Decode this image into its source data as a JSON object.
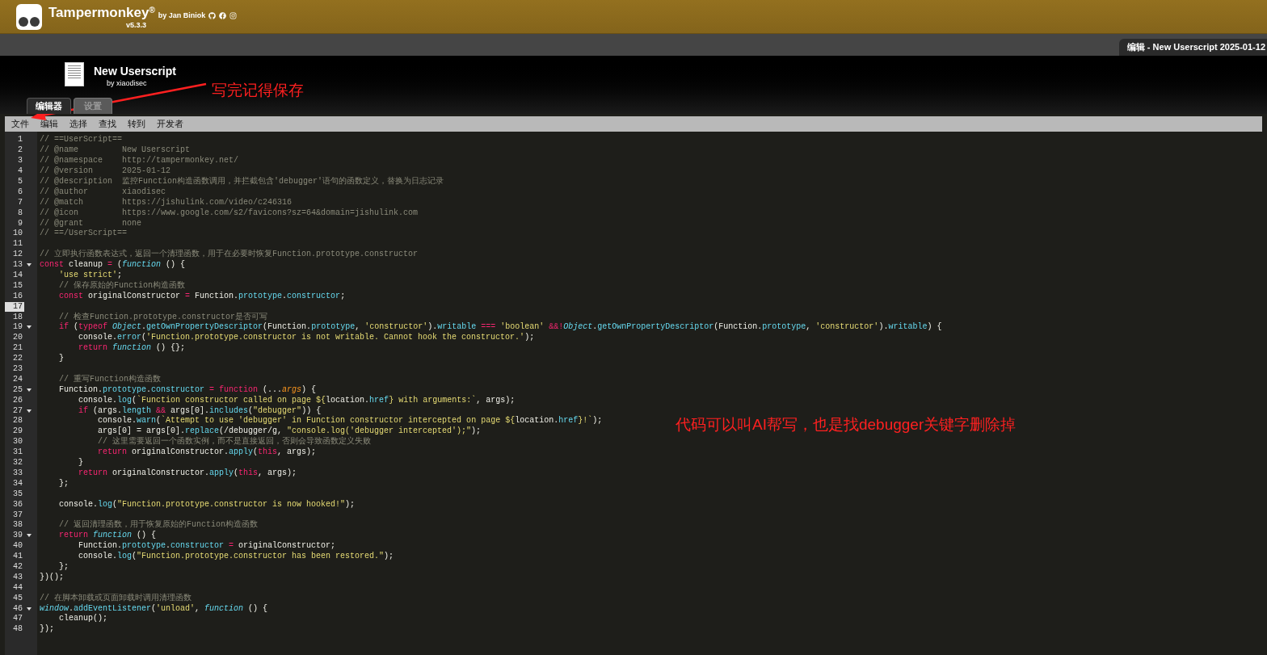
{
  "app": {
    "name": "Tampermonkey",
    "mark": "®",
    "byline": "by Jan Biniok",
    "version": "v5.3.3"
  },
  "open_tab": {
    "label": "编辑 - New Userscript 2025-01-12"
  },
  "script": {
    "title": "New Userscript",
    "author": "by xiaodisec"
  },
  "tabs": [
    {
      "label": "编辑器",
      "selected": true
    },
    {
      "label": "设置",
      "selected": false
    }
  ],
  "menu": [
    "文件",
    "编辑",
    "选择",
    "查找",
    "转到",
    "开发者"
  ],
  "editor": {
    "lines": [
      {
        "number": "1",
        "fold": false,
        "active": false,
        "tokens": [
          {
            "kind": "comment",
            "text": "// ==UserScript=="
          }
        ]
      },
      {
        "number": "2",
        "fold": false,
        "active": false,
        "tokens": [
          {
            "kind": "comment",
            "text": "// @name         New Userscript"
          }
        ]
      },
      {
        "number": "3",
        "fold": false,
        "active": false,
        "tokens": [
          {
            "kind": "comment",
            "text": "// @namespace    http://tampermonkey.net/"
          }
        ]
      },
      {
        "number": "4",
        "fold": false,
        "active": false,
        "tokens": [
          {
            "kind": "comment",
            "text": "// @version      2025-01-12"
          }
        ]
      },
      {
        "number": "5",
        "fold": false,
        "active": false,
        "tokens": [
          {
            "kind": "comment",
            "text": "// @description  监控Function构造函数调用，并拦截包含'debugger'语句的函数定义，替换为日志记录"
          }
        ]
      },
      {
        "number": "6",
        "fold": false,
        "active": false,
        "tokens": [
          {
            "kind": "comment",
            "text": "// @author       xiaodisec"
          }
        ]
      },
      {
        "number": "7",
        "fold": false,
        "active": false,
        "tokens": [
          {
            "kind": "comment",
            "text": "// @match        https://jishulink.com/video/c246316"
          }
        ]
      },
      {
        "number": "8",
        "fold": false,
        "active": false,
        "tokens": [
          {
            "kind": "comment",
            "text": "// @icon         https://www.google.com/s2/favicons?sz=64&domain=jishulink.com"
          }
        ]
      },
      {
        "number": "9",
        "fold": false,
        "active": false,
        "tokens": [
          {
            "kind": "comment",
            "text": "// @grant        none"
          }
        ]
      },
      {
        "number": "10",
        "fold": false,
        "active": false,
        "tokens": [
          {
            "kind": "comment",
            "text": "// ==/UserScript=="
          }
        ]
      },
      {
        "number": "11",
        "fold": false,
        "active": false
      },
      {
        "number": "12",
        "fold": false,
        "active": false,
        "tokens": [
          {
            "kind": "comment",
            "text": "// 立即执行函数表达式，返回一个清理函数，用于在必要时恢复Function.prototype.constructor"
          }
        ]
      },
      {
        "number": "13",
        "fold": true,
        "active": false,
        "tokens": [
          {
            "kind": "keyword",
            "text": "const"
          },
          {
            "kind": "plain",
            "text": " cleanup "
          },
          {
            "kind": "keyword",
            "text": "="
          },
          {
            "kind": "plain",
            "text": " ("
          },
          {
            "kind": "italic",
            "text": "function"
          },
          {
            "kind": "plain",
            "text": " () {"
          }
        ]
      },
      {
        "number": "14",
        "fold": false,
        "active": false,
        "tokens": [
          {
            "kind": "string",
            "text": "    'use strict'"
          },
          {
            "kind": "plain",
            "text": ";"
          }
        ]
      },
      {
        "number": "15",
        "fold": false,
        "active": false,
        "tokens": [
          {
            "kind": "comment",
            "text": "    // 保存原始的Function构造函数"
          }
        ]
      },
      {
        "number": "16",
        "fold": false,
        "active": false,
        "tokens": [
          {
            "kind": "keyword",
            "text": "    const"
          },
          {
            "kind": "plain",
            "text": " originalConstructor "
          },
          {
            "kind": "keyword",
            "text": "="
          },
          {
            "kind": "plain",
            "text": " Function."
          },
          {
            "kind": "member",
            "text": "prototype"
          },
          {
            "kind": "plain",
            "text": "."
          },
          {
            "kind": "member",
            "text": "constructor"
          },
          {
            "kind": "plain",
            "text": ";"
          }
        ]
      },
      {
        "number": "17",
        "fold": false,
        "active": true
      },
      {
        "number": "18",
        "fold": false,
        "active": false,
        "tokens": [
          {
            "kind": "comment",
            "text": "    // 检查Function.prototype.constructor是否可写"
          }
        ]
      },
      {
        "number": "19",
        "fold": true,
        "active": false,
        "tokens": [
          {
            "kind": "keyword",
            "text": "    if"
          },
          {
            "kind": "plain",
            "text": " ("
          },
          {
            "kind": "keyword",
            "text": "typeof "
          },
          {
            "kind": "italic",
            "text": "Object"
          },
          {
            "kind": "plain",
            "text": "."
          },
          {
            "kind": "member",
            "text": "getOwnPropertyDescriptor"
          },
          {
            "kind": "plain",
            "text": "(Function."
          },
          {
            "kind": "member",
            "text": "prototype"
          },
          {
            "kind": "plain",
            "text": ", "
          },
          {
            "kind": "string",
            "text": "'constructor'"
          },
          {
            "kind": "plain",
            "text": ")."
          },
          {
            "kind": "member",
            "text": "writable "
          },
          {
            "kind": "keyword",
            "text": "=== "
          },
          {
            "kind": "string",
            "text": "'boolean' "
          },
          {
            "kind": "keyword",
            "text": "&&!"
          },
          {
            "kind": "italic",
            "text": "Object"
          },
          {
            "kind": "plain",
            "text": "."
          },
          {
            "kind": "member",
            "text": "getOwnPropertyDescriptor"
          },
          {
            "kind": "plain",
            "text": "(Function."
          },
          {
            "kind": "member",
            "text": "prototype"
          },
          {
            "kind": "plain",
            "text": ", "
          },
          {
            "kind": "string",
            "text": "'constructor'"
          },
          {
            "kind": "plain",
            "text": ")."
          },
          {
            "kind": "member",
            "text": "writable"
          },
          {
            "kind": "plain",
            "text": ") {"
          }
        ]
      },
      {
        "number": "20",
        "fold": false,
        "active": false,
        "tokens": [
          {
            "kind": "plain",
            "text": "        console."
          },
          {
            "kind": "member",
            "text": "error"
          },
          {
            "kind": "plain",
            "text": "("
          },
          {
            "kind": "string",
            "text": "'Function.prototype.constructor is not writable. Cannot hook the constructor.'"
          },
          {
            "kind": "plain",
            "text": ");"
          }
        ]
      },
      {
        "number": "21",
        "fold": false,
        "active": false,
        "tokens": [
          {
            "kind": "keyword",
            "text": "        return "
          },
          {
            "kind": "italic",
            "text": "function"
          },
          {
            "kind": "plain",
            "text": " () {};"
          }
        ]
      },
      {
        "number": "22",
        "fold": false,
        "active": false,
        "tokens": [
          {
            "kind": "plain",
            "text": "    }"
          }
        ]
      },
      {
        "number": "23",
        "fold": false,
        "active": false
      },
      {
        "number": "24",
        "fold": false,
        "active": false,
        "tokens": [
          {
            "kind": "comment",
            "text": "    // 重写Function构造函数"
          }
        ]
      },
      {
        "number": "25",
        "fold": true,
        "active": false,
        "tokens": [
          {
            "kind": "plain",
            "text": "    Function."
          },
          {
            "kind": "member",
            "text": "prototype"
          },
          {
            "kind": "plain",
            "text": "."
          },
          {
            "kind": "member",
            "text": "constructor "
          },
          {
            "kind": "keyword",
            "text": "= function"
          },
          {
            "kind": "plain",
            "text": " (..."
          },
          {
            "kind": "param",
            "text": "args"
          },
          {
            "kind": "plain",
            "text": ") {"
          }
        ]
      },
      {
        "number": "26",
        "fold": false,
        "active": false,
        "tokens": [
          {
            "kind": "plain",
            "text": "        console."
          },
          {
            "kind": "member",
            "text": "log"
          },
          {
            "kind": "plain",
            "text": "("
          },
          {
            "kind": "string",
            "text": "`Function constructor called on page ${"
          },
          {
            "kind": "plain",
            "text": "location."
          },
          {
            "kind": "member",
            "text": "href"
          },
          {
            "kind": "string",
            "text": "} with arguments:`"
          },
          {
            "kind": "plain",
            "text": ", args);"
          }
        ]
      },
      {
        "number": "27",
        "fold": true,
        "active": false,
        "tokens": [
          {
            "kind": "keyword",
            "text": "        if"
          },
          {
            "kind": "plain",
            "text": " (args."
          },
          {
            "kind": "member",
            "text": "length "
          },
          {
            "kind": "keyword",
            "text": "&&"
          },
          {
            "kind": "plain",
            "text": " args[0]."
          },
          {
            "kind": "member",
            "text": "includes"
          },
          {
            "kind": "plain",
            "text": "("
          },
          {
            "kind": "string",
            "text": "\"debugger\""
          },
          {
            "kind": "plain",
            "text": ")) {"
          }
        ]
      },
      {
        "number": "28",
        "fold": false,
        "active": false,
        "tokens": [
          {
            "kind": "plain",
            "text": "            console."
          },
          {
            "kind": "member",
            "text": "warn"
          },
          {
            "kind": "plain",
            "text": "("
          },
          {
            "kind": "string",
            "text": "`Attempt to use 'debugger' in Function constructor intercepted on page ${"
          },
          {
            "kind": "plain",
            "text": "location."
          },
          {
            "kind": "member",
            "text": "href"
          },
          {
            "kind": "string",
            "text": "}!`"
          },
          {
            "kind": "plain",
            "text": ");"
          }
        ]
      },
      {
        "number": "29",
        "fold": false,
        "active": false,
        "tokens": [
          {
            "kind": "plain",
            "text": "            args[0] = args[0]."
          },
          {
            "kind": "member",
            "text": "replace"
          },
          {
            "kind": "plain",
            "text": "(/debugger/g, "
          },
          {
            "kind": "string",
            "text": "\"console.log('debugger intercepted');\""
          },
          {
            "kind": "plain",
            "text": ");"
          }
        ]
      },
      {
        "number": "30",
        "fold": false,
        "active": false,
        "tokens": [
          {
            "kind": "comment",
            "text": "            // 这里需要返回一个函数实例，而不是直接返回，否则会导致函数定义失败"
          }
        ]
      },
      {
        "number": "31",
        "fold": false,
        "active": false,
        "tokens": [
          {
            "kind": "keyword",
            "text": "            return"
          },
          {
            "kind": "plain",
            "text": " originalConstructor."
          },
          {
            "kind": "member",
            "text": "apply"
          },
          {
            "kind": "plain",
            "text": "("
          },
          {
            "kind": "keyword",
            "text": "this"
          },
          {
            "kind": "plain",
            "text": ", args);"
          }
        ]
      },
      {
        "number": "32",
        "fold": false,
        "active": false,
        "tokens": [
          {
            "kind": "plain",
            "text": "        }"
          }
        ]
      },
      {
        "number": "33",
        "fold": false,
        "active": false,
        "tokens": [
          {
            "kind": "keyword",
            "text": "        return"
          },
          {
            "kind": "plain",
            "text": " originalConstructor."
          },
          {
            "kind": "member",
            "text": "apply"
          },
          {
            "kind": "plain",
            "text": "("
          },
          {
            "kind": "keyword",
            "text": "this"
          },
          {
            "kind": "plain",
            "text": ", args);"
          }
        ]
      },
      {
        "number": "34",
        "fold": false,
        "active": false,
        "tokens": [
          {
            "kind": "plain",
            "text": "    };"
          }
        ]
      },
      {
        "number": "35",
        "fold": false,
        "active": false
      },
      {
        "number": "36",
        "fold": false,
        "active": false,
        "tokens": [
          {
            "kind": "plain",
            "text": "    console."
          },
          {
            "kind": "member",
            "text": "log"
          },
          {
            "kind": "plain",
            "text": "("
          },
          {
            "kind": "string",
            "text": "\"Function.prototype.constructor is now hooked!\""
          },
          {
            "kind": "plain",
            "text": ");"
          }
        ]
      },
      {
        "number": "37",
        "fold": false,
        "active": false
      },
      {
        "number": "38",
        "fold": false,
        "active": false,
        "tokens": [
          {
            "kind": "comment",
            "text": "    // 返回清理函数，用于恢复原始的Function构造函数"
          }
        ]
      },
      {
        "number": "39",
        "fold": true,
        "active": false,
        "tokens": [
          {
            "kind": "keyword",
            "text": "    return "
          },
          {
            "kind": "italic",
            "text": "function"
          },
          {
            "kind": "plain",
            "text": " () {"
          }
        ]
      },
      {
        "number": "40",
        "fold": false,
        "active": false,
        "tokens": [
          {
            "kind": "plain",
            "text": "        Function."
          },
          {
            "kind": "member",
            "text": "prototype"
          },
          {
            "kind": "plain",
            "text": "."
          },
          {
            "kind": "member",
            "text": "constructor "
          },
          {
            "kind": "keyword",
            "text": "="
          },
          {
            "kind": "plain",
            "text": " originalConstructor;"
          }
        ]
      },
      {
        "number": "41",
        "fold": false,
        "active": false,
        "tokens": [
          {
            "kind": "plain",
            "text": "        console."
          },
          {
            "kind": "member",
            "text": "log"
          },
          {
            "kind": "plain",
            "text": "("
          },
          {
            "kind": "string",
            "text": "\"Function.prototype.constructor has been restored.\""
          },
          {
            "kind": "plain",
            "text": ");"
          }
        ]
      },
      {
        "number": "42",
        "fold": false,
        "active": false,
        "tokens": [
          {
            "kind": "plain",
            "text": "    };"
          }
        ]
      },
      {
        "number": "43",
        "fold": false,
        "active": false,
        "tokens": [
          {
            "kind": "plain",
            "text": "})();"
          }
        ]
      },
      {
        "number": "44",
        "fold": false,
        "active": false
      },
      {
        "number": "45",
        "fold": false,
        "active": false,
        "tokens": [
          {
            "kind": "comment",
            "text": "// 在脚本卸载或页面卸载时调用清理函数"
          }
        ]
      },
      {
        "number": "46",
        "fold": true,
        "active": false,
        "tokens": [
          {
            "kind": "italic",
            "text": "window"
          },
          {
            "kind": "plain",
            "text": "."
          },
          {
            "kind": "member",
            "text": "addEventListener"
          },
          {
            "kind": "plain",
            "text": "("
          },
          {
            "kind": "string",
            "text": "'unload'"
          },
          {
            "kind": "plain",
            "text": ", "
          },
          {
            "kind": "italic",
            "text": "function"
          },
          {
            "kind": "plain",
            "text": " () {"
          }
        ]
      },
      {
        "number": "47",
        "fold": false,
        "active": false,
        "tokens": [
          {
            "kind": "plain",
            "text": "    cleanup();"
          }
        ]
      },
      {
        "number": "48",
        "fold": false,
        "active": false,
        "tokens": [
          {
            "kind": "plain",
            "text": "});"
          }
        ]
      }
    ]
  },
  "annotations": [
    {
      "text": "写完记得保存"
    },
    {
      "text": "代码可以叫AI帮写，也是找debugger关键字删除掉"
    }
  ]
}
